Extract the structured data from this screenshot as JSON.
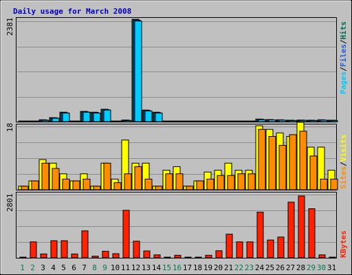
{
  "title": "Daily usage for March 2008",
  "colors": {
    "background": "#c0c0c0",
    "plot_bg": "#c0c0c0",
    "grid": "#8c8c8c",
    "title": "#0000c0",
    "pages": "#00ccff",
    "files": "#1f5fd7",
    "hits": "#006f55",
    "visits": "#ffff00",
    "sites": "#ff8c00",
    "kbytes": "#ff2200",
    "weekday_label": "#000000",
    "weekend_label": "#007a4d"
  },
  "panels": {
    "hits": {
      "ymax_label": "2381",
      "labels": [
        "Pages",
        "/",
        "Files",
        "/",
        "Hits"
      ]
    },
    "visits": {
      "ymax_label": "18",
      "labels": [
        "Sites",
        "/",
        "Visits"
      ]
    },
    "kbytes": {
      "ymax_label": "2801",
      "labels": [
        "KBytes"
      ]
    }
  },
  "chart_data": [
    {
      "type": "bar",
      "title": "Daily usage for March 2008",
      "categories": [
        "1",
        "2",
        "3",
        "4",
        "5",
        "6",
        "7",
        "8",
        "9",
        "10",
        "11",
        "12",
        "13",
        "14",
        "15",
        "16",
        "17",
        "18",
        "19",
        "20",
        "21",
        "22",
        "23",
        "24",
        "25",
        "26",
        "27",
        "28",
        "29",
        "30",
        "31"
      ],
      "weekend_days": [
        "1",
        "2",
        "8",
        "9",
        "15",
        "16",
        "22",
        "23",
        "29",
        "30"
      ],
      "ylim": [
        0,
        2381
      ],
      "series": [
        {
          "name": "Hits",
          "values": [
            10,
            10,
            45,
            95,
            220,
            10,
            240,
            220,
            290,
            10,
            40,
            2381,
            270,
            220,
            10,
            10,
            10,
            10,
            10,
            10,
            10,
            10,
            10,
            60,
            50,
            45,
            35,
            40,
            35,
            45,
            35
          ]
        },
        {
          "name": "Files",
          "values": [
            5,
            5,
            40,
            90,
            210,
            5,
            230,
            210,
            280,
            5,
            35,
            2360,
            260,
            210,
            5,
            5,
            5,
            5,
            5,
            5,
            5,
            5,
            5,
            55,
            45,
            40,
            30,
            35,
            30,
            40,
            30
          ]
        },
        {
          "name": "Pages",
          "values": [
            3,
            3,
            30,
            80,
            200,
            3,
            220,
            200,
            270,
            3,
            25,
            2340,
            250,
            200,
            3,
            3,
            3,
            3,
            3,
            3,
            3,
            3,
            3,
            45,
            40,
            35,
            25,
            30,
            25,
            35,
            25
          ]
        }
      ]
    },
    {
      "type": "bar",
      "categories": [
        "1",
        "2",
        "3",
        "4",
        "5",
        "6",
        "7",
        "8",
        "9",
        "10",
        "11",
        "12",
        "13",
        "14",
        "15",
        "16",
        "17",
        "18",
        "19",
        "20",
        "21",
        "22",
        "23",
        "24",
        "25",
        "26",
        "27",
        "28",
        "29",
        "30",
        "31"
      ],
      "ylim": [
        0,
        18
      ],
      "series": [
        {
          "name": "Visits",
          "values": [
            1,
            2.5,
            8.5,
            7.5,
            4.5,
            2.5,
            4.5,
            1,
            7.5,
            3,
            14,
            7.5,
            7.5,
            1,
            5.5,
            6.5,
            1,
            2.5,
            5,
            5.5,
            7.5,
            5.5,
            5.5,
            18,
            17,
            16,
            15,
            19,
            12,
            12,
            5.5
          ]
        },
        {
          "name": "Sites",
          "values": [
            1,
            2.5,
            7.5,
            6,
            3,
            2.5,
            3,
            1,
            7.5,
            2,
            4.5,
            6.5,
            3,
            1,
            4.5,
            4.5,
            1,
            2.5,
            3,
            4,
            4,
            4.5,
            4.5,
            17,
            15,
            12.5,
            15.5,
            16.5,
            9.5,
            3,
            3
          ]
        }
      ]
    },
    {
      "type": "bar",
      "categories": [
        "1",
        "2",
        "3",
        "4",
        "5",
        "6",
        "7",
        "8",
        "9",
        "10",
        "11",
        "12",
        "13",
        "14",
        "15",
        "16",
        "17",
        "18",
        "19",
        "20",
        "21",
        "22",
        "23",
        "24",
        "25",
        "26",
        "27",
        "28",
        "29",
        "30",
        "31"
      ],
      "ylim": [
        0,
        2801
      ],
      "series": [
        {
          "name": "KBytes",
          "values": [
            20,
            700,
            170,
            750,
            750,
            170,
            1180,
            75,
            290,
            180,
            2080,
            730,
            300,
            130,
            30,
            110,
            30,
            30,
            110,
            310,
            1040,
            700,
            700,
            2000,
            780,
            910,
            2440,
            2710,
            2150,
            130,
            20
          ]
        }
      ]
    }
  ]
}
